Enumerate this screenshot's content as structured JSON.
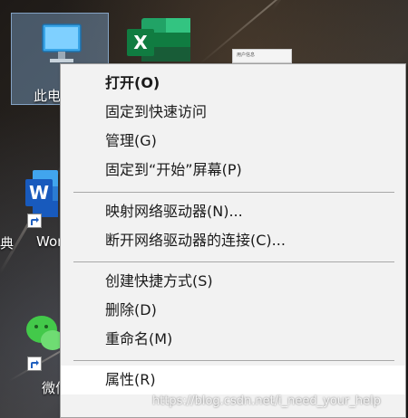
{
  "desktop": {
    "icons": [
      {
        "label": "此电脑"
      },
      {
        "label": "Word"
      },
      {
        "label": "微信"
      }
    ],
    "left_clip_char": "典",
    "doc_thumb_text": "用户信息"
  },
  "context_menu": {
    "items": [
      {
        "label": "打开(O)",
        "bold": true
      },
      {
        "label": "固定到快速访问"
      },
      {
        "label": "管理(G)"
      },
      {
        "label": "固定到“开始”屏幕(P)"
      },
      {
        "label": "映射网络驱动器(N)..."
      },
      {
        "label": "断开网络驱动器的连接(C)..."
      },
      {
        "label": "创建快捷方式(S)"
      },
      {
        "label": "删除(D)"
      },
      {
        "label": "重命名(M)"
      },
      {
        "label": "属性(R)",
        "hovered": true
      }
    ]
  },
  "watermark": "https://blog.csdn.net/i_need_your_help",
  "colors": {
    "menu_bg": "#f2f2f2",
    "menu_hover": "#ffffff",
    "selection": "#99ccff",
    "excel_green": "#1d6f42",
    "word_blue": "#2b5797",
    "wechat_green": "#43c94a"
  }
}
